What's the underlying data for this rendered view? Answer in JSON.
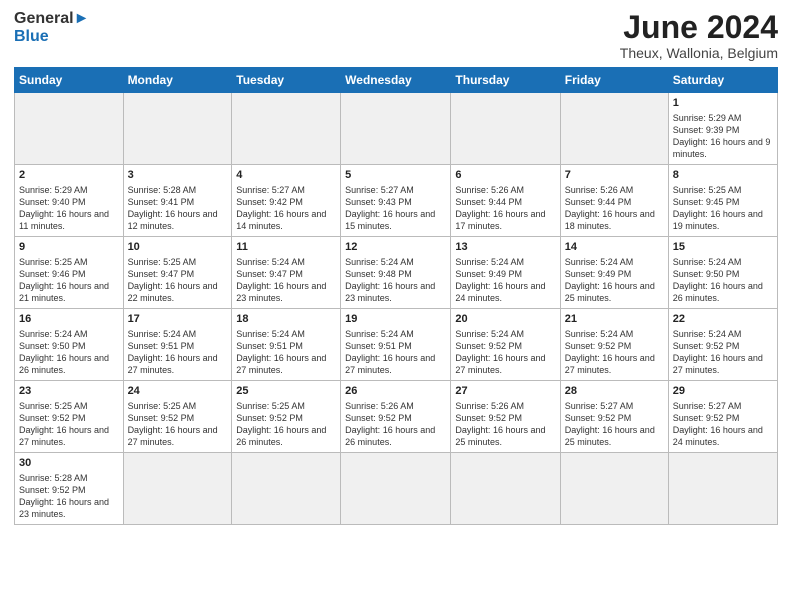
{
  "header": {
    "logo_general": "General",
    "logo_blue": "Blue",
    "title": "June 2024",
    "location": "Theux, Wallonia, Belgium"
  },
  "days_of_week": [
    "Sunday",
    "Monday",
    "Tuesday",
    "Wednesday",
    "Thursday",
    "Friday",
    "Saturday"
  ],
  "weeks": [
    [
      {
        "day": "",
        "empty": true
      },
      {
        "day": "",
        "empty": true
      },
      {
        "day": "",
        "empty": true
      },
      {
        "day": "",
        "empty": true
      },
      {
        "day": "",
        "empty": true
      },
      {
        "day": "",
        "empty": true
      },
      {
        "day": "1",
        "info": "Sunrise: 5:29 AM\nSunset: 9:39 PM\nDaylight: 16 hours\nand 9 minutes."
      }
    ],
    [
      {
        "day": "2",
        "info": "Sunrise: 5:29 AM\nSunset: 9:40 PM\nDaylight: 16 hours\nand 11 minutes."
      },
      {
        "day": "3",
        "info": "Sunrise: 5:28 AM\nSunset: 9:41 PM\nDaylight: 16 hours\nand 12 minutes."
      },
      {
        "day": "4",
        "info": "Sunrise: 5:27 AM\nSunset: 9:42 PM\nDaylight: 16 hours\nand 14 minutes."
      },
      {
        "day": "5",
        "info": "Sunrise: 5:27 AM\nSunset: 9:43 PM\nDaylight: 16 hours\nand 15 minutes."
      },
      {
        "day": "6",
        "info": "Sunrise: 5:26 AM\nSunset: 9:44 PM\nDaylight: 16 hours\nand 17 minutes."
      },
      {
        "day": "7",
        "info": "Sunrise: 5:26 AM\nSunset: 9:44 PM\nDaylight: 16 hours\nand 18 minutes."
      },
      {
        "day": "8",
        "info": "Sunrise: 5:25 AM\nSunset: 9:45 PM\nDaylight: 16 hours\nand 19 minutes."
      }
    ],
    [
      {
        "day": "9",
        "info": "Sunrise: 5:25 AM\nSunset: 9:46 PM\nDaylight: 16 hours\nand 21 minutes."
      },
      {
        "day": "10",
        "info": "Sunrise: 5:25 AM\nSunset: 9:47 PM\nDaylight: 16 hours\nand 22 minutes."
      },
      {
        "day": "11",
        "info": "Sunrise: 5:24 AM\nSunset: 9:47 PM\nDaylight: 16 hours\nand 23 minutes."
      },
      {
        "day": "12",
        "info": "Sunrise: 5:24 AM\nSunset: 9:48 PM\nDaylight: 16 hours\nand 23 minutes."
      },
      {
        "day": "13",
        "info": "Sunrise: 5:24 AM\nSunset: 9:49 PM\nDaylight: 16 hours\nand 24 minutes."
      },
      {
        "day": "14",
        "info": "Sunrise: 5:24 AM\nSunset: 9:49 PM\nDaylight: 16 hours\nand 25 minutes."
      },
      {
        "day": "15",
        "info": "Sunrise: 5:24 AM\nSunset: 9:50 PM\nDaylight: 16 hours\nand 26 minutes."
      }
    ],
    [
      {
        "day": "16",
        "info": "Sunrise: 5:24 AM\nSunset: 9:50 PM\nDaylight: 16 hours\nand 26 minutes."
      },
      {
        "day": "17",
        "info": "Sunrise: 5:24 AM\nSunset: 9:51 PM\nDaylight: 16 hours\nand 27 minutes."
      },
      {
        "day": "18",
        "info": "Sunrise: 5:24 AM\nSunset: 9:51 PM\nDaylight: 16 hours\nand 27 minutes."
      },
      {
        "day": "19",
        "info": "Sunrise: 5:24 AM\nSunset: 9:51 PM\nDaylight: 16 hours\nand 27 minutes."
      },
      {
        "day": "20",
        "info": "Sunrise: 5:24 AM\nSunset: 9:52 PM\nDaylight: 16 hours\nand 27 minutes."
      },
      {
        "day": "21",
        "info": "Sunrise: 5:24 AM\nSunset: 9:52 PM\nDaylight: 16 hours\nand 27 minutes."
      },
      {
        "day": "22",
        "info": "Sunrise: 5:24 AM\nSunset: 9:52 PM\nDaylight: 16 hours\nand 27 minutes."
      }
    ],
    [
      {
        "day": "23",
        "info": "Sunrise: 5:25 AM\nSunset: 9:52 PM\nDaylight: 16 hours\nand 27 minutes."
      },
      {
        "day": "24",
        "info": "Sunrise: 5:25 AM\nSunset: 9:52 PM\nDaylight: 16 hours\nand 27 minutes."
      },
      {
        "day": "25",
        "info": "Sunrise: 5:25 AM\nSunset: 9:52 PM\nDaylight: 16 hours\nand 26 minutes."
      },
      {
        "day": "26",
        "info": "Sunrise: 5:26 AM\nSunset: 9:52 PM\nDaylight: 16 hours\nand 26 minutes."
      },
      {
        "day": "27",
        "info": "Sunrise: 5:26 AM\nSunset: 9:52 PM\nDaylight: 16 hours\nand 25 minutes."
      },
      {
        "day": "28",
        "info": "Sunrise: 5:27 AM\nSunset: 9:52 PM\nDaylight: 16 hours\nand 25 minutes."
      },
      {
        "day": "29",
        "info": "Sunrise: 5:27 AM\nSunset: 9:52 PM\nDaylight: 16 hours\nand 24 minutes."
      }
    ],
    [
      {
        "day": "30",
        "info": "Sunrise: 5:28 AM\nSunset: 9:52 PM\nDaylight: 16 hours\nand 23 minutes."
      },
      {
        "day": "",
        "empty": true
      },
      {
        "day": "",
        "empty": true
      },
      {
        "day": "",
        "empty": true
      },
      {
        "day": "",
        "empty": true
      },
      {
        "day": "",
        "empty": true
      },
      {
        "day": "",
        "empty": true
      }
    ]
  ]
}
